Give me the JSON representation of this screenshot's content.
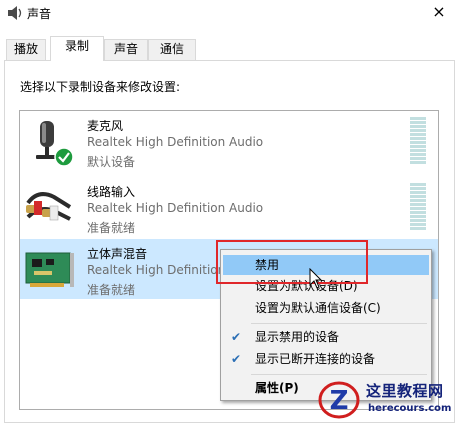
{
  "window": {
    "title": "声音",
    "close_glyph": "×"
  },
  "tabs": [
    {
      "label": "播放"
    },
    {
      "label": "录制",
      "active": true
    },
    {
      "label": "声音"
    },
    {
      "label": "通信"
    }
  ],
  "instruction": "选择以下录制设备来修改设置:",
  "devices": [
    {
      "name": "麦克风",
      "driver": "Realtek High Definition Audio",
      "status": "默认设备",
      "icon": "microphone-icon",
      "badge": "default-check-icon"
    },
    {
      "name": "线路输入",
      "driver": "Realtek High Definition Audio",
      "status": "准备就绪",
      "icon": "line-in-cable-icon"
    },
    {
      "name": "立体声混音",
      "driver": "Realtek High Definition Audio",
      "status": "准备就绪",
      "icon": "sound-card-icon",
      "selected": true
    }
  ],
  "context_menu": {
    "items": [
      {
        "label": "禁用",
        "highlighted": true
      },
      {
        "label": "设置为默认设备(D)"
      },
      {
        "label": "设置为默认通信设备(C)"
      },
      {
        "label": "显示禁用的设备",
        "checked": true
      },
      {
        "label": "显示已断开连接的设备",
        "checked": true
      },
      {
        "label": "属性(P)",
        "bold": true
      }
    ],
    "check_glyph": "✔"
  },
  "watermark": {
    "title": "这里教程网",
    "url": "herecours.com"
  },
  "colors": {
    "selection": "#cce8ff",
    "menu_highlight": "#91c9f7",
    "annotation_box": "#e0272a",
    "watermark": "#14237a"
  }
}
